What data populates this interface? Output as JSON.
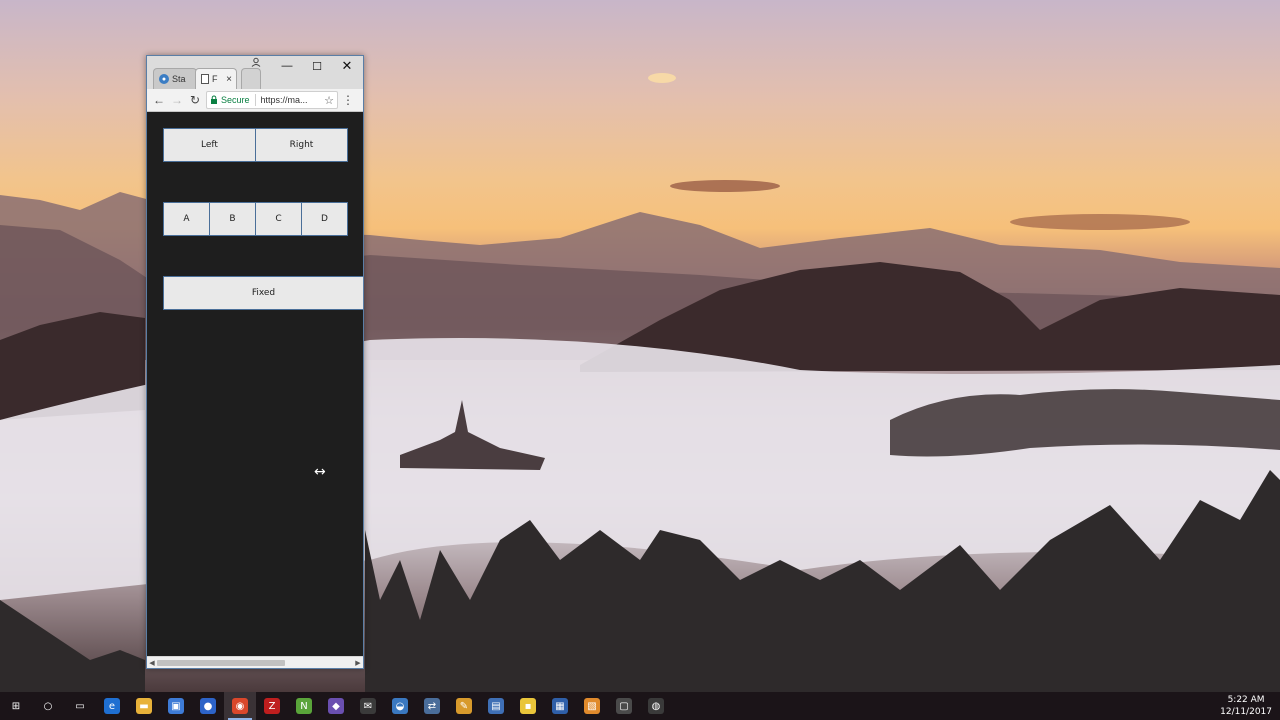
{
  "browser": {
    "tabs": [
      {
        "label": "Sta",
        "favicon": "stackoverflow-icon"
      },
      {
        "label": "F",
        "favicon": "page-icon"
      }
    ],
    "tab_close": "×",
    "window_controls": {
      "minimize": "—",
      "maximize": "☐",
      "close": "✕"
    },
    "secure_label": "Secure",
    "url": "https://ma...",
    "nav": {
      "back": "←",
      "forward": "→",
      "reload": "↻"
    },
    "star": "☆",
    "menu": "⋮"
  },
  "page": {
    "row1": [
      "Left",
      "Right"
    ],
    "row2": [
      "A",
      "B",
      "C",
      "D"
    ],
    "fixed_label": "Fixed",
    "cursor": "↔"
  },
  "scrollbar": {
    "left_arrow": "◀",
    "right_arrow": "▶"
  },
  "taskbar": {
    "items": [
      {
        "name": "start-icon",
        "glyph": "⊞",
        "color": "#1b1418"
      },
      {
        "name": "search-icon",
        "glyph": "○",
        "color": "#1b1418"
      },
      {
        "name": "task-view-icon",
        "glyph": "▭",
        "color": "#1b1418"
      },
      {
        "name": "edge-icon",
        "glyph": "e",
        "color": "#1f6fd1"
      },
      {
        "name": "file-explorer-icon",
        "glyph": "▬",
        "color": "#e8b23a"
      },
      {
        "name": "store-icon",
        "glyph": "▣",
        "color": "#3e7bd6"
      },
      {
        "name": "firefox-icon",
        "glyph": "●",
        "color": "#2d63c8"
      },
      {
        "name": "chrome-icon",
        "glyph": "◉",
        "color": "#d9472b"
      },
      {
        "name": "filezilla-icon",
        "glyph": "Z",
        "color": "#bf1e1e"
      },
      {
        "name": "notepadpp-icon",
        "glyph": "N",
        "color": "#5aa43a"
      },
      {
        "name": "vs-icon",
        "glyph": "◆",
        "color": "#6a4fb0"
      },
      {
        "name": "mail-icon",
        "glyph": "✉",
        "color": "#3a3a3a"
      },
      {
        "name": "app-icon-1",
        "glyph": "◒",
        "color": "#3a78c0"
      },
      {
        "name": "network-icon",
        "glyph": "⇄",
        "color": "#4a6d9a"
      },
      {
        "name": "app-icon-2",
        "glyph": "✎",
        "color": "#d89a2c"
      },
      {
        "name": "document-icon",
        "glyph": "▤",
        "color": "#3f6fb5"
      },
      {
        "name": "sticky-notes-icon",
        "glyph": "▪",
        "color": "#e9c53a"
      },
      {
        "name": "app-icon-3",
        "glyph": "▦",
        "color": "#2f5fa8"
      },
      {
        "name": "app-icon-4",
        "glyph": "▧",
        "color": "#e08a2c"
      },
      {
        "name": "app-icon-5",
        "glyph": "▢",
        "color": "#4a4a4a"
      },
      {
        "name": "app-icon-6",
        "glyph": "◍",
        "color": "#3a3a3a"
      }
    ],
    "active_index": 7,
    "time": "5:22 AM",
    "date": "12/11/2017"
  }
}
